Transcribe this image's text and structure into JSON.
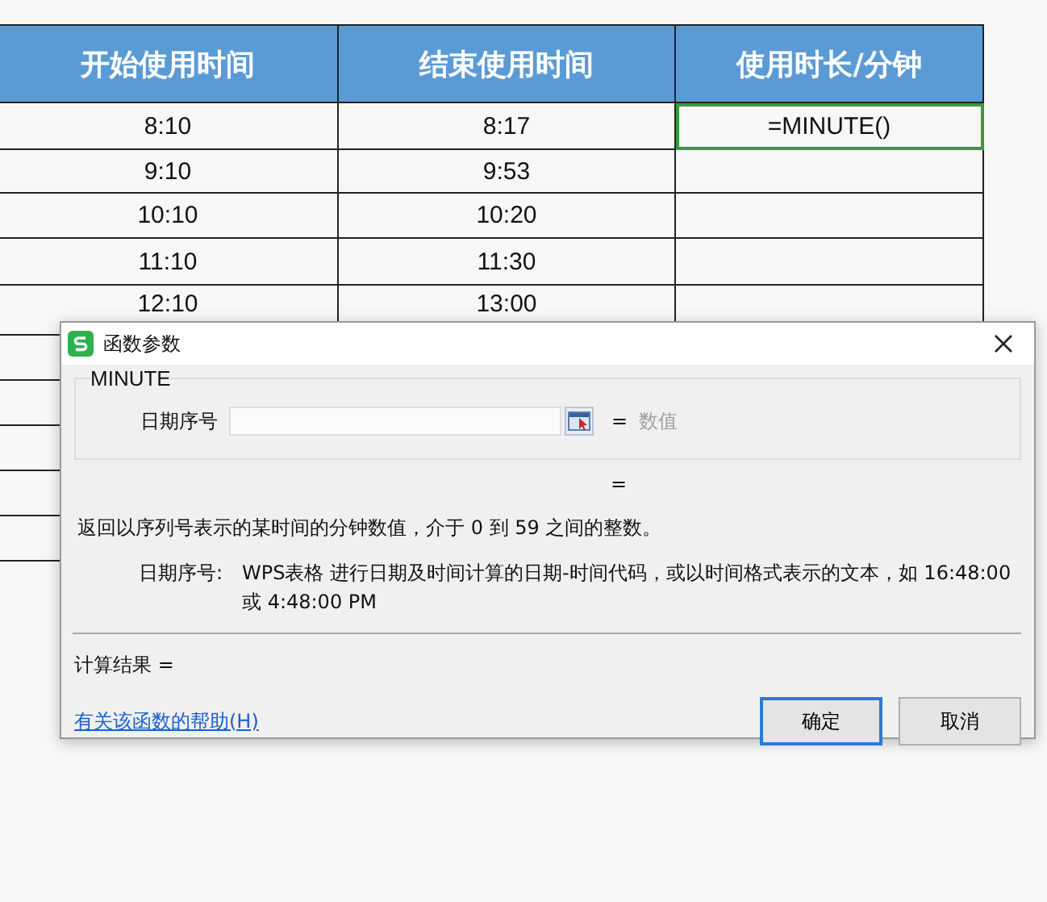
{
  "table": {
    "columns": [
      "开始使用时间",
      "结束使用时间",
      "使用时长/分钟"
    ],
    "rows": [
      {
        "start": "8:10",
        "end": "8:17",
        "duration": "=MINUTE()",
        "selected": true
      },
      {
        "start": "9:10",
        "end": "9:53",
        "selected": false
      },
      {
        "start": "10:10",
        "end": "10:20",
        "selected": false
      },
      {
        "start": "11:10",
        "end": "11:30",
        "selected": false
      },
      {
        "start": "12:10",
        "end": "13:00",
        "selected": false
      }
    ]
  },
  "dialog": {
    "title": "函数参数",
    "function_name": "MINUTE",
    "argument": {
      "label": "日期序号",
      "equals": "=",
      "result_hint": "数值"
    },
    "formula_result": "=",
    "description": "返回以序列号表示的某时间的分钟数值，介于 0 到 59 之间的整数。",
    "argument_help": {
      "label": "日期序号:",
      "text": "WPS表格 进行日期及时间计算的日期-时间代码，或以时间格式表示的文本，如 16:48:00 或 4:48:00 PM"
    },
    "result_label": "计算结果 =",
    "help_link": "有关该函数的帮助(H)",
    "buttons": [
      {
        "label": "确定",
        "primary": true
      },
      {
        "label": "取消",
        "primary": false
      }
    ]
  }
}
